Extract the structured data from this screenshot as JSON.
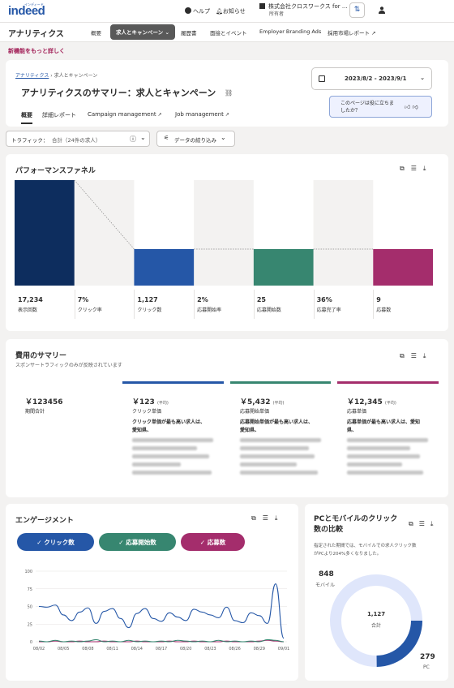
{
  "topbar": {
    "logo": "indeed",
    "logo_sub": "インディード",
    "help": "ヘルプ",
    "notifications": "お知らせ",
    "org_name": "株式会社クロスワークス for ...",
    "org_role": "所有者"
  },
  "nav": {
    "title": "アナリティクス",
    "tabs": [
      {
        "label": "概要"
      },
      {
        "label": "求人とキャンペーン ⌄"
      },
      {
        "label": "履歴書"
      },
      {
        "label": "面接とイベント"
      },
      {
        "label": "Employer Branding Ads"
      },
      {
        "label": "採用市場レポート ↗"
      }
    ]
  },
  "new_feature": "新機能をもっと詳しく",
  "header": {
    "breadcrumb_root": "アナリティクス",
    "breadcrumb_sep": "›",
    "breadcrumb_current": "求人とキャンペーン",
    "title": "アナリティクスのサマリー：求人とキャンペーン",
    "tabs": [
      "概要",
      "詳細レポート",
      "Campaign management",
      "Job management"
    ],
    "date_range": "2023/8/2 - 2023/9/1",
    "feedback_q1": "このページは役に立ちま",
    "feedback_q2": "したか？"
  },
  "filters": {
    "traffic_label": "トラフィック：",
    "traffic_value": "合計（24件の求人）",
    "refine_label": "データの絞り込み"
  },
  "funnel": {
    "title": "パフォーマンスファネル",
    "stages": [
      {
        "value": "17,234",
        "label": "表示回数"
      },
      {
        "value": "7%",
        "label": "クリック率"
      },
      {
        "value": "1,127",
        "label": "クリック数"
      },
      {
        "value": "2%",
        "label": "応募開始率"
      },
      {
        "value": "25",
        "label": "応募開始数"
      },
      {
        "value": "36%",
        "label": "応募完了率"
      },
      {
        "value": "9",
        "label": "応募数"
      }
    ],
    "colors": {
      "impressions": "#0d2d5e",
      "clicks": "#2557a7",
      "starts": "#378670",
      "applies": "#a42d6c"
    }
  },
  "cost": {
    "title": "費用のサマリー",
    "subtitle": "スポンサートラフィックのみが反映されています",
    "total_value": "￥123456",
    "total_label": "期間合計",
    "columns": [
      {
        "value": "￥123",
        "avg": "(平均)",
        "label": "クリック単価",
        "note1": "クリック単価が最も高い求人は、",
        "note2": "愛知県、"
      },
      {
        "value": "￥5,432",
        "avg": "(平均)",
        "label": "応募開始単価",
        "note1": "応募開始単価が最も高い求人は、",
        "note2": "愛知県、"
      },
      {
        "value": "￥12,345",
        "avg": "(平均)",
        "label": "応募単価",
        "note1": "応募単価が最も高い求人は、愛知",
        "note2": "県、"
      }
    ]
  },
  "engagement": {
    "title": "エンゲージメント",
    "pills": [
      "クリック数",
      "応募開始数",
      "応募数"
    ]
  },
  "chart_data": {
    "type": "line",
    "title": "エンゲージメント",
    "xlabel": "",
    "ylabel": "",
    "ylim": [
      0,
      100
    ],
    "y_ticks": [
      "100",
      "75",
      "50",
      "25",
      "0"
    ],
    "x_ticks": [
      "08/02",
      "08/05",
      "08/08",
      "08/11",
      "08/14",
      "08/17",
      "08/20",
      "08/23",
      "08/26",
      "08/29",
      "09/01"
    ],
    "series": [
      {
        "name": "クリック数",
        "color": "#2557a7",
        "values": [
          50,
          49,
          52,
          38,
          30,
          42,
          48,
          26,
          43,
          47,
          33,
          20,
          40,
          47,
          33,
          29,
          41,
          35,
          30,
          46,
          42,
          38,
          34,
          49,
          30,
          27,
          41,
          37,
          26,
          82,
          5
        ]
      },
      {
        "name": "応募開始数",
        "color": "#378670",
        "values": [
          1,
          0,
          2,
          0,
          1,
          0,
          1,
          3,
          0,
          1,
          0,
          2,
          0,
          1,
          0,
          1,
          0,
          2,
          1,
          0,
          1,
          0,
          2,
          0,
          1,
          0,
          1,
          0,
          3,
          2,
          0
        ]
      },
      {
        "name": "応募数",
        "color": "#a42d6c",
        "values": [
          0,
          0,
          1,
          0,
          0,
          1,
          0,
          0,
          1,
          0,
          0,
          0,
          1,
          0,
          0,
          0,
          1,
          0,
          0,
          1,
          0,
          0,
          0,
          1,
          0,
          0,
          0,
          1,
          2,
          1,
          0
        ]
      }
    ]
  },
  "device": {
    "title1": "PCとモバイルのクリック",
    "title2": "数の比較",
    "desc1": "指定された期間では、モバイルでの求人クリック数",
    "desc2": "がPCより204%多くなりました。",
    "mobile_value": "848",
    "mobile_label": "モバイル",
    "total_value": "1,127",
    "total_label": "合計",
    "pc_value": "279",
    "pc_label": "PC",
    "mobile_share": 0.752,
    "pc_share": 0.248
  }
}
